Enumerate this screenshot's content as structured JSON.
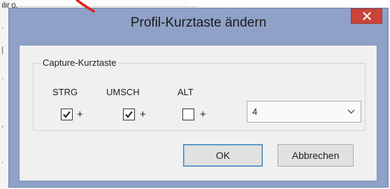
{
  "background": {
    "left_fragment": "ılır or"
  },
  "dialog": {
    "title": "Profil-Kurztaste ändern",
    "close_symbol": "×",
    "group_label": "Capture-Kurztaste",
    "modifiers": [
      {
        "label": "STRG",
        "checked": true
      },
      {
        "label": "UMSCH",
        "checked": true
      },
      {
        "label": "ALT",
        "checked": false
      }
    ],
    "plus_sign": "+",
    "key_select": {
      "value": "4"
    },
    "buttons": {
      "ok": "OK",
      "cancel": "Abbrechen"
    }
  },
  "colors": {
    "titlebar": "#8fa1c7",
    "close_button": "#c9453a",
    "client_bg": "#f0f0f0",
    "annotation_arrow": "#e32020"
  }
}
